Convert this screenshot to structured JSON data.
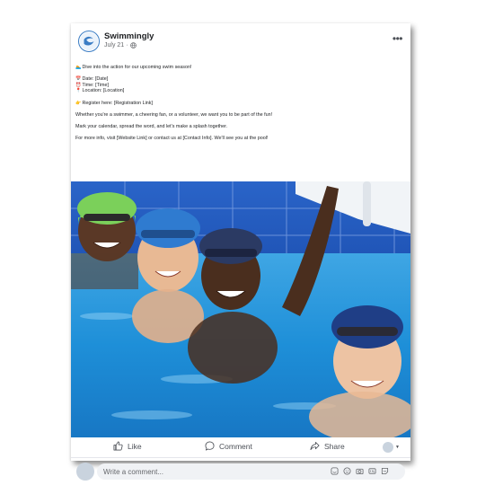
{
  "post": {
    "page_name": "Swimmingly",
    "date": "July 21",
    "dot_separator": "·",
    "more_label": "•••",
    "caption": {
      "intro_emoji": "🏊",
      "intro": "Dive into the action for our upcoming swim season!",
      "date_emoji": "📅",
      "date_line": "Date: [Date]",
      "time_emoji": "⏰",
      "time_line": "Time: [Time]",
      "location_emoji": "📍",
      "location_line": "Location: [Location]",
      "register_emoji": "👉",
      "register_line": "Register here: [Registration Link]",
      "line_swimmer": "Whether you're a swimmer, a cheering fan, or a volunteer, we want you to be part of the fun!",
      "line_calendar": "Mark your calendar, spread the word, and let's make a splash together.",
      "line_info": "For more info, visit [Website Link] or contact us at [Contact Info]. We'll see you at the pool!"
    }
  },
  "actions": {
    "like": "Like",
    "comment": "Comment",
    "share": "Share",
    "reaction_caret": "▼"
  },
  "comment_box": {
    "placeholder": "Write a comment..."
  },
  "icons": {
    "avatar": "swimmingly-logo-icon",
    "privacy": "globe-icon",
    "more": "more-icon",
    "like": "thumbs-up-icon",
    "comment": "speech-bubble-icon",
    "share": "share-arrow-icon",
    "comment_tools": [
      "sticker-icon",
      "emoji-icon",
      "camera-icon",
      "gif-icon",
      "sticker-smile-icon"
    ]
  },
  "colors": {
    "brand": "#3a7cc4",
    "text": "#1c1e21",
    "muted": "#65676b",
    "pool_water": "#1e8fd8"
  }
}
